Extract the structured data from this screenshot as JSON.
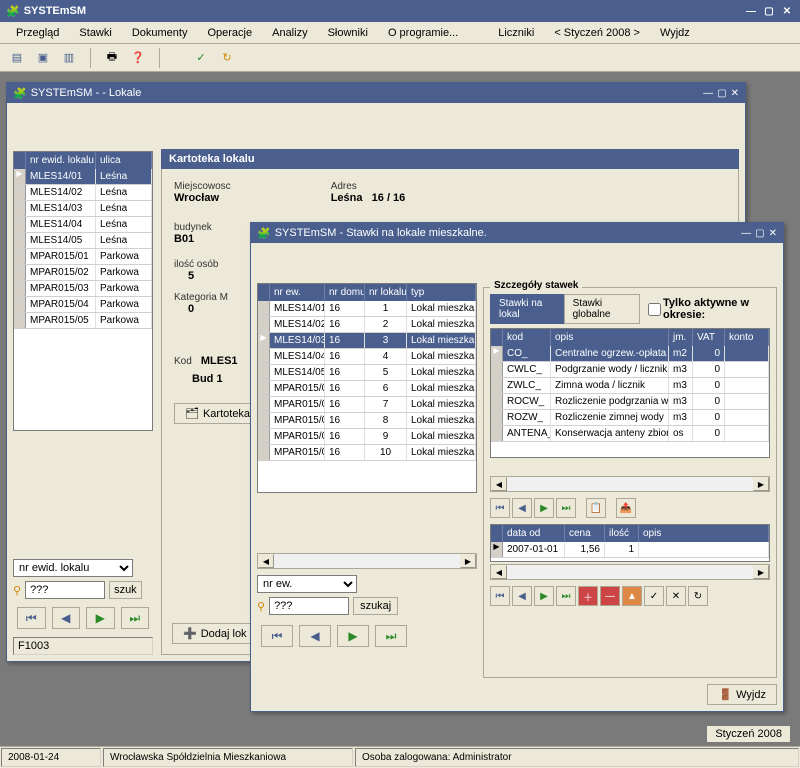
{
  "app_title": "SYSTEmSM",
  "menu": [
    "Przegląd",
    "Stawki",
    "Dokumenty",
    "Operacje",
    "Analizy",
    "Słowniki",
    "O programie...",
    "Liczniki",
    "< Styczeń 2008 >",
    "Wyjdz"
  ],
  "window1": {
    "title": "SYSTEmSM -  - Lokale",
    "headers": [
      "nr ewid. lokalu",
      "ulica"
    ],
    "rows": [
      {
        "id": "MLES14/01",
        "street": "Leśna",
        "sel": true
      },
      {
        "id": "MLES14/02",
        "street": "Leśna"
      },
      {
        "id": "MLES14/03",
        "street": "Leśna"
      },
      {
        "id": "MLES14/04",
        "street": "Leśna"
      },
      {
        "id": "MLES14/05",
        "street": "Leśna"
      },
      {
        "id": "MPAR015/01",
        "street": "Parkowa"
      },
      {
        "id": "MPAR015/02",
        "street": "Parkowa"
      },
      {
        "id": "MPAR015/03",
        "street": "Parkowa"
      },
      {
        "id": "MPAR015/04",
        "street": "Parkowa"
      },
      {
        "id": "MPAR015/05",
        "street": "Parkowa"
      }
    ],
    "filter_field": "nr ewid. lokalu",
    "search_val": "???",
    "search_btn": "szuk",
    "add_btn": "Dodaj lok",
    "status_code": "F1003",
    "panel": {
      "title": "Kartoteka lokalu",
      "miejscowosc_lbl": "Miejscowosc",
      "miejscowosc": "Wrocław",
      "adres_lbl": "Adres",
      "adres_street": "Leśna",
      "adres_num": "16 /  16",
      "budynek_lbl": "budynek",
      "budynek": "B01",
      "liczba_lbl": "ilość osób",
      "liczba": "5",
      "kat_lbl": "Kategoria M",
      "kat": "0",
      "kod_lbl": "Kod",
      "kod": "MLES1",
      "bud_lbl": "Bud 1",
      "kartoteka_btn": "Kartoteka"
    }
  },
  "window2": {
    "title": "SYSTEmSM -  Stawki na lokale mieszkalne.",
    "headers": [
      "nr ew.",
      "nr domu",
      "nr lokalu",
      "typ"
    ],
    "rows": [
      {
        "ew": "MLES14/01",
        "dom": "16",
        "lok": "1",
        "typ": "Lokal mieszkaniow"
      },
      {
        "ew": "MLES14/02",
        "dom": "16",
        "lok": "2",
        "typ": "Lokal mieszkaniow"
      },
      {
        "ew": "MLES14/03",
        "dom": "16",
        "lok": "3",
        "typ": "Lokal mieszkaniow",
        "sel": true
      },
      {
        "ew": "MLES14/04",
        "dom": "16",
        "lok": "4",
        "typ": "Lokal mieszkaniow"
      },
      {
        "ew": "MLES14/05",
        "dom": "16",
        "lok": "5",
        "typ": "Lokal mieszkaniow"
      },
      {
        "ew": "MPAR015/0",
        "dom": "16",
        "lok": "6",
        "typ": "Lokal mieszkaniow"
      },
      {
        "ew": "MPAR015/0",
        "dom": "16",
        "lok": "7",
        "typ": "Lokal mieszkaniow"
      },
      {
        "ew": "MPAR015/0",
        "dom": "16",
        "lok": "8",
        "typ": "Lokal mieszkaniow"
      },
      {
        "ew": "MPAR015/0",
        "dom": "16",
        "lok": "9",
        "typ": "Lokal mieszkaniow"
      },
      {
        "ew": "MPAR015/0",
        "dom": "16",
        "lok": "10",
        "typ": "Lokal mieszkaniow"
      }
    ],
    "filter_field": "nr ew.",
    "search_val": "???",
    "search_btn": "szukaj",
    "details": {
      "title": "Szczegóły stawek",
      "tab1": "Stawki na lokal",
      "tab2": "Stawki globalne",
      "checkbox": "Tylko aktywne w okresie:",
      "headers": [
        "kod",
        "opis",
        "jm.",
        "VAT",
        "konto"
      ],
      "rows": [
        {
          "kod": "CO_",
          "opis": "Centralne ogrzew.-opłata",
          "jm": "m2",
          "vat": "0",
          "sel": true
        },
        {
          "kod": "CWLC_",
          "opis": "Podgrzanie wody / licznik",
          "jm": "m3",
          "vat": "0"
        },
        {
          "kod": "ZWLC_",
          "opis": "Zimna woda / licznik",
          "jm": "m3",
          "vat": "0"
        },
        {
          "kod": "ROCW_",
          "opis": "Rozliczenie podgrzania w",
          "jm": "m3",
          "vat": "0"
        },
        {
          "kod": "ROZW_",
          "opis": "Rozliczenie zimnej wody",
          "jm": "m3",
          "vat": "0"
        },
        {
          "kod": "ANTENA_",
          "opis": "Konserwacja anteny zbior",
          "jm": "os",
          "vat": "0"
        }
      ],
      "sub_headers": [
        "data od",
        "cena",
        "ilość",
        "opis"
      ],
      "sub_rows": [
        {
          "data": "2007-01-01",
          "cena": "1,56",
          "ilosc": "1",
          "opis": ""
        }
      ]
    },
    "exit_btn": "Wyjdz"
  },
  "status": {
    "date": "2008-01-24",
    "org": "Wrocławska Spółdzielnia Mieszkaniowa",
    "user": "Osoba zalogowana: Administrator",
    "period": "Styczeń 2008"
  }
}
